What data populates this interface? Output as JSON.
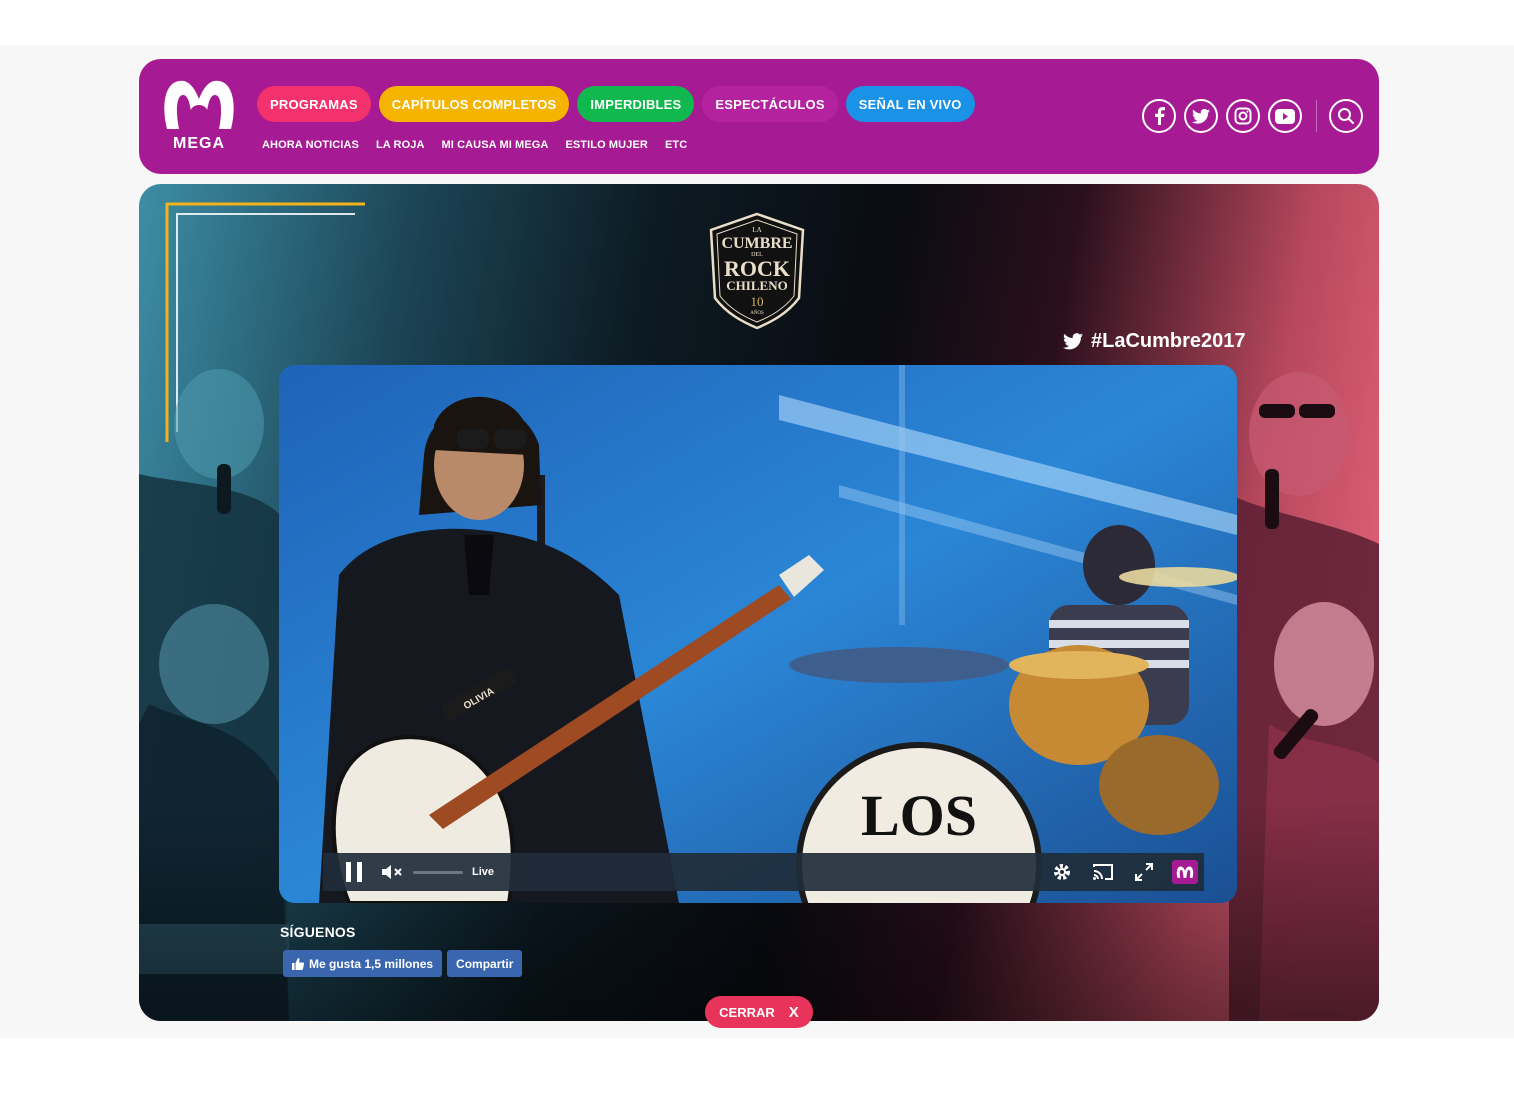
{
  "brand": {
    "logo_text": "MEGA",
    "header_color": "#a61a93"
  },
  "primary_nav": [
    {
      "label": "PROGRAMAS",
      "color": "#f2316d"
    },
    {
      "label": "CAPÍTULOS COMPLETOS",
      "color": "#f5b400"
    },
    {
      "label": "IMPERDIBLES",
      "color": "#10b84e"
    },
    {
      "label": "ESPECTÁCULOS",
      "color": "#b4229f"
    },
    {
      "label": "SEÑAL EN VIVO",
      "color": "#1a92e8"
    }
  ],
  "secondary_nav": [
    "AHORA NOTICIAS",
    "LA ROJA",
    "MI CAUSA MI MEGA",
    "ESTILO MUJER",
    "ETC"
  ],
  "social_icons": [
    "facebook-icon",
    "twitter-icon",
    "instagram-icon",
    "youtube-icon",
    "search-icon"
  ],
  "event": {
    "logo_lines": [
      "LA",
      "CUMBRE",
      "DEL",
      "ROCK",
      "CHILENO",
      "10",
      "AÑOS"
    ],
    "hashtag": "#LaCumbre2017"
  },
  "player": {
    "status": "Live",
    "bass_drum_text": "LOS",
    "guitar_strap_text": "OLIVIA",
    "volume_muted": true,
    "volume_level": 0
  },
  "follow": {
    "heading": "SÍGUENOS",
    "like_label": "Me gusta 1,5 millones",
    "share_label": "Compartir"
  },
  "close": {
    "label": "CERRAR",
    "icon": "X"
  }
}
